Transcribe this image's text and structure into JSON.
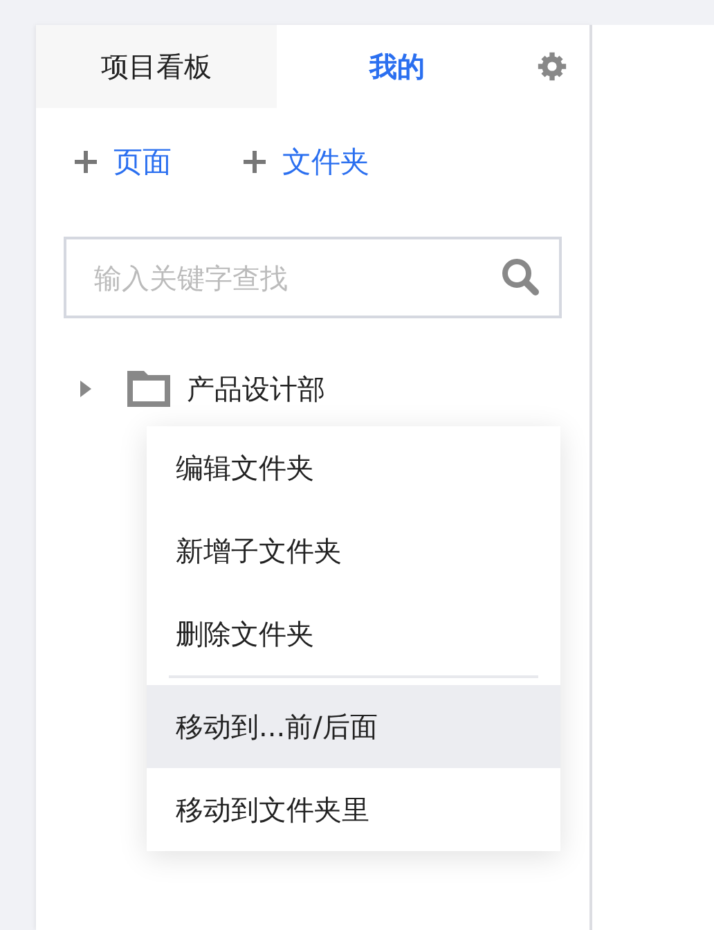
{
  "tabs": [
    {
      "label": "项目看板",
      "selected": false
    },
    {
      "label": "我的",
      "selected": true
    }
  ],
  "add_actions": [
    "页面",
    "文件夹"
  ],
  "search": {
    "placeholder": "输入关键字查找"
  },
  "tree": [
    {
      "label": "产品设计部",
      "expanded": false
    }
  ],
  "context_menu": [
    {
      "kind": "item",
      "label": "编辑文件夹",
      "highlighted": false
    },
    {
      "kind": "item",
      "label": "新增子文件夹",
      "highlighted": false
    },
    {
      "kind": "item",
      "label": "删除文件夹",
      "highlighted": false
    },
    {
      "kind": "divider"
    },
    {
      "kind": "item",
      "label": "移动到...前/后面",
      "highlighted": true
    },
    {
      "kind": "item",
      "label": "移动到文件夹里",
      "highlighted": false
    }
  ]
}
